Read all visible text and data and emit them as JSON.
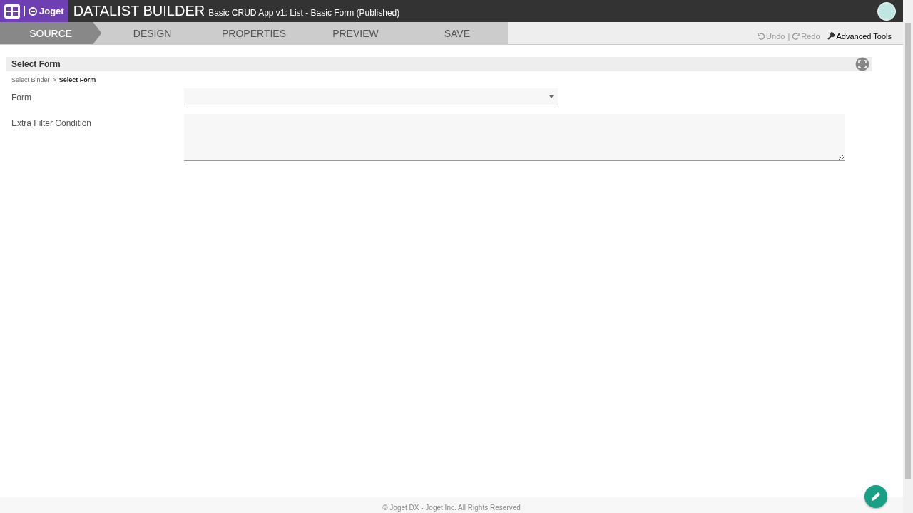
{
  "header": {
    "logo": "Joget",
    "title": "DATALIST BUILDER",
    "subtitle": "Basic CRUD App v1: List - Basic Form (Published)"
  },
  "steps": [
    {
      "label": "SOURCE",
      "selected": true
    },
    {
      "label": "DESIGN",
      "selected": false
    },
    {
      "label": "PROPERTIES",
      "selected": false
    },
    {
      "label": "PREVIEW",
      "selected": false
    },
    {
      "label": "SAVE",
      "selected": false
    }
  ],
  "toolbar": {
    "undo": {
      "label": "Undo",
      "disabled": true
    },
    "separator": "|",
    "redo": {
      "label": "Redo",
      "disabled": true
    },
    "advanced": "Advanced Tools"
  },
  "panel": {
    "title": "Select Form",
    "breadcrumb": [
      {
        "label": "Select Binder",
        "selected": false
      },
      {
        "label": "Select Form",
        "selected": true
      }
    ],
    "breadcrumb_separator": ">"
  },
  "fields": [
    {
      "kind": "select",
      "label": "Form"
    },
    {
      "kind": "textarea",
      "label": "Extra Filter Condition"
    }
  ],
  "footer": "© Joget DX - Joget Inc. All Rights Reserved"
}
